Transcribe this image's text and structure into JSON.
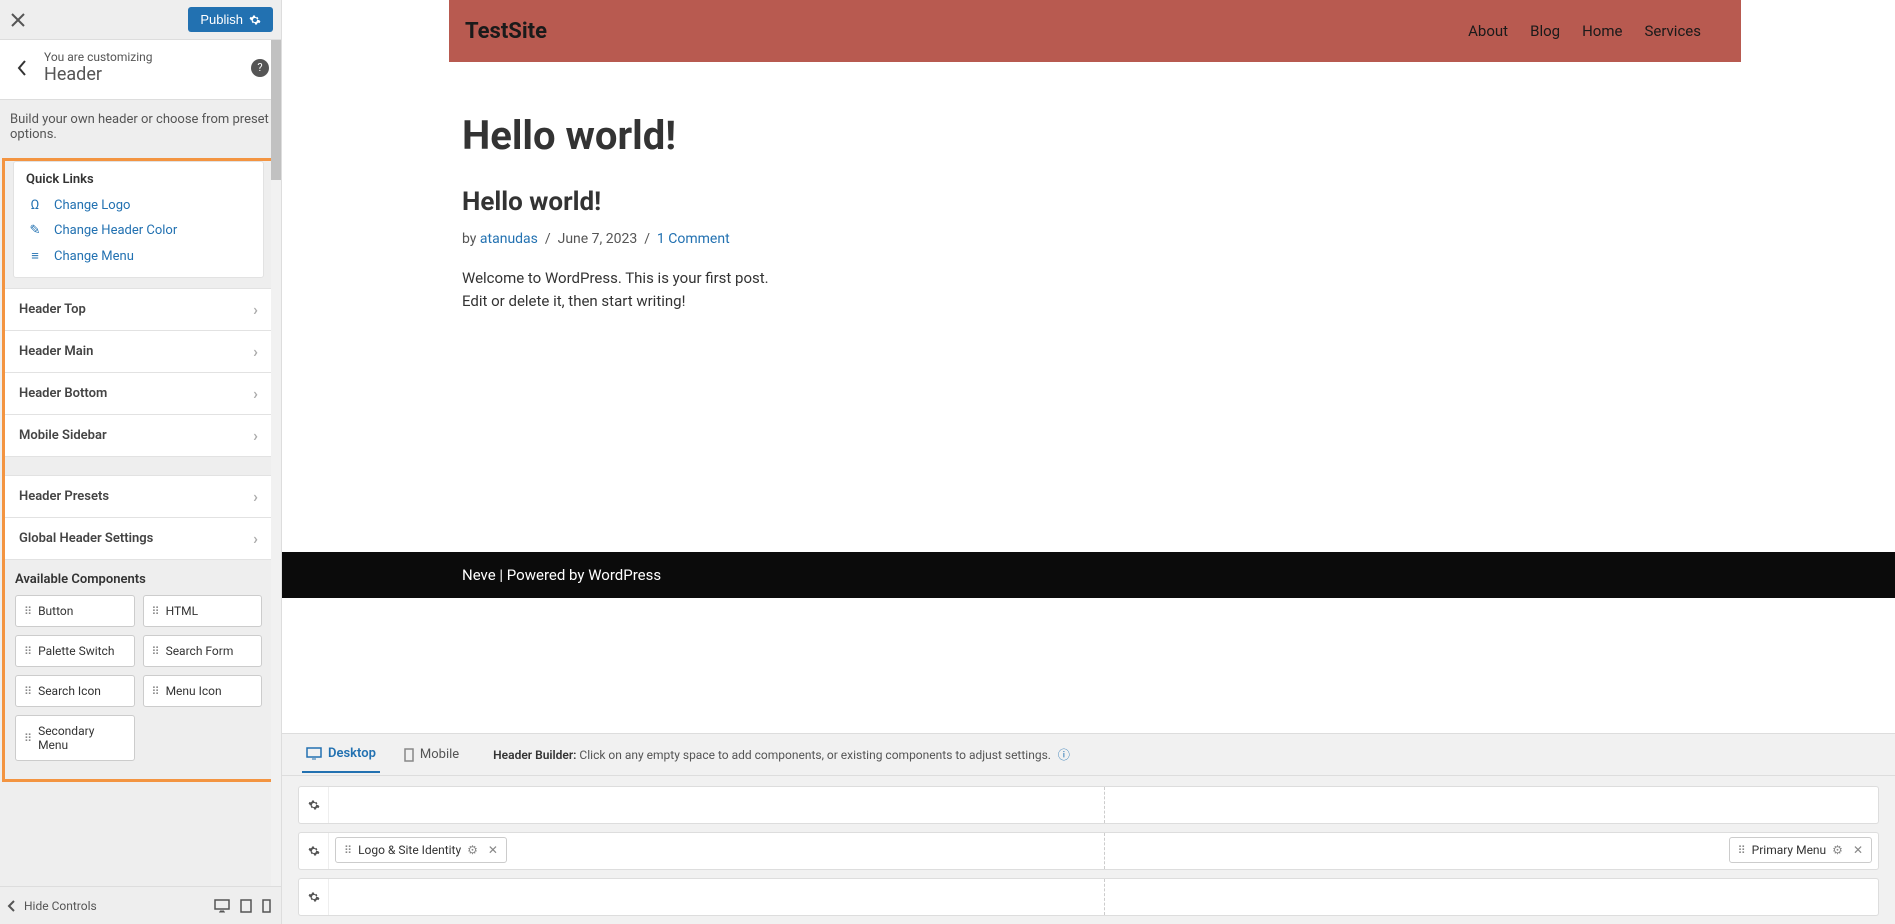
{
  "sidebar": {
    "publish_label": "Publish",
    "customizing_label": "You are customizing",
    "panel_title": "Header",
    "description": "Build your own header or choose from preset options.",
    "quick_links_title": "Quick Links",
    "quick_links": [
      {
        "label": "Change Logo",
        "icon": "Ω"
      },
      {
        "label": "Change Header Color",
        "icon": "✎"
      },
      {
        "label": "Change Menu",
        "icon": "≡"
      }
    ],
    "sections_a": [
      {
        "label": "Header Top"
      },
      {
        "label": "Header Main"
      },
      {
        "label": "Header Bottom"
      },
      {
        "label": "Mobile Sidebar"
      }
    ],
    "sections_b": [
      {
        "label": "Header Presets"
      },
      {
        "label": "Global Header Settings"
      }
    ],
    "available_title": "Available Components",
    "components": [
      {
        "label": "Button"
      },
      {
        "label": "HTML"
      },
      {
        "label": "Palette Switch"
      },
      {
        "label": "Search Form"
      },
      {
        "label": "Search Icon"
      },
      {
        "label": "Menu Icon"
      },
      {
        "label": "Secondary Menu"
      }
    ],
    "hide_controls": "Hide Controls"
  },
  "preview": {
    "site_title": "TestSite",
    "nav": [
      "About",
      "Blog",
      "Home",
      "Services"
    ],
    "page_title": "Hello world!",
    "post_title": "Hello world!",
    "by": "by",
    "author": "atanudas",
    "sep": "/",
    "date": "June 7, 2023",
    "comments": "1 Comment",
    "body": "Welcome to WordPress. This is your first post. Edit or delete it, then start writing!",
    "footer_theme": "Neve",
    "footer_sep": " | Powered by ",
    "footer_wp": "WordPress"
  },
  "builder": {
    "tabs": {
      "desktop": "Desktop",
      "mobile": "Mobile"
    },
    "hint_label": "Header Builder:",
    "hint_text": "Click on any empty space to add components, or existing components to adjust settings.",
    "slot_logo": "Logo & Site Identity",
    "slot_menu": "Primary Menu"
  }
}
